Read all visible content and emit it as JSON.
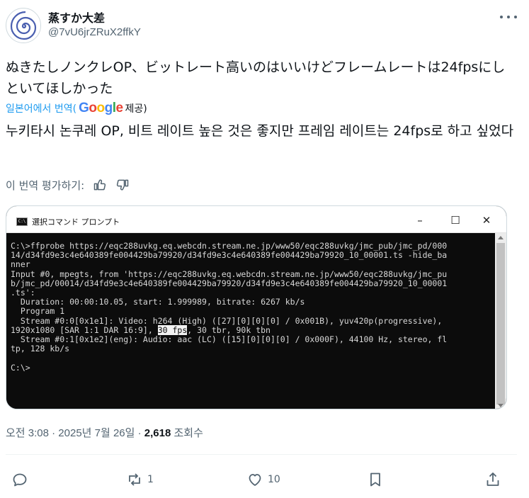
{
  "author": {
    "display_name": "蒸すか大差",
    "handle": "@7vU6jrZRuX2ffkY"
  },
  "tweet": {
    "text": "ぬきたしノンクレOP、ビットレート高いのはいいけどフレームレートは24fpsにしといてほしかった",
    "translated_prefix": "일본어에서 번역(",
    "translated_brand": "Google",
    "translated_suffix": "제공)",
    "translation": "누키타시 논쿠레 OP, 비트 레이트 높은 것은 좋지만 프레임 레이트는 24fps로 하고 싶었다",
    "rate_label": "이 번역 평가하기:"
  },
  "media": {
    "window_title": "選択コマンド プロンプト",
    "controls": [
      "–",
      "☐",
      "✕"
    ],
    "console_lines": [
      "C:\\>ffprobe https://eqc288uvkg.eq.webcdn.stream.ne.jp/www50/eqc288uvkg/jmc_pub/jmc_pd/000",
      "14/d34fd9e3c4e640389fe004429ba79920/d34fd9e3c4e640389fe004429ba79920_10_00001.ts -hide_ba",
      "nner",
      "Input #0, mpegts, from 'https://eqc288uvkg.eq.webcdn.stream.ne.jp/www50/eqc288uvkg/jmc_pu",
      "b/jmc_pd/00014/d34fd9e3c4e640389fe004429ba79920/d34fd9e3c4e640389fe004429ba79920_10_00001",
      ".ts':",
      "  Duration: 00:00:10.05, start: 1.999989, bitrate: 6267 kb/s",
      "  Program 1",
      "  Stream #0:0[0x1e1]: Video: h264 (High) ([27][0][0][0] / 0x001B), yuv420p(progressive),",
      "  Stream #0:1[0x1e2](eng): Audio: aac (LC) ([15][0][0][0] / 0x000F), 44100 Hz, stereo, fl",
      "tp, 128 kb/s",
      "",
      "C:\\>"
    ],
    "res_line_before": "1920x1080 [SAR 1:1 DAR 16:9], ",
    "res_line_highlight": "30 fps",
    "res_line_after": ", 30 tbr, 90k tbn"
  },
  "meta": {
    "time": "오전 3:08 · 2025년 7월 26일 · ",
    "views_count": "2,618",
    "views_label": " 조회수"
  },
  "actions": {
    "reply_count": "",
    "repost_count": "1",
    "like_count": "10"
  }
}
